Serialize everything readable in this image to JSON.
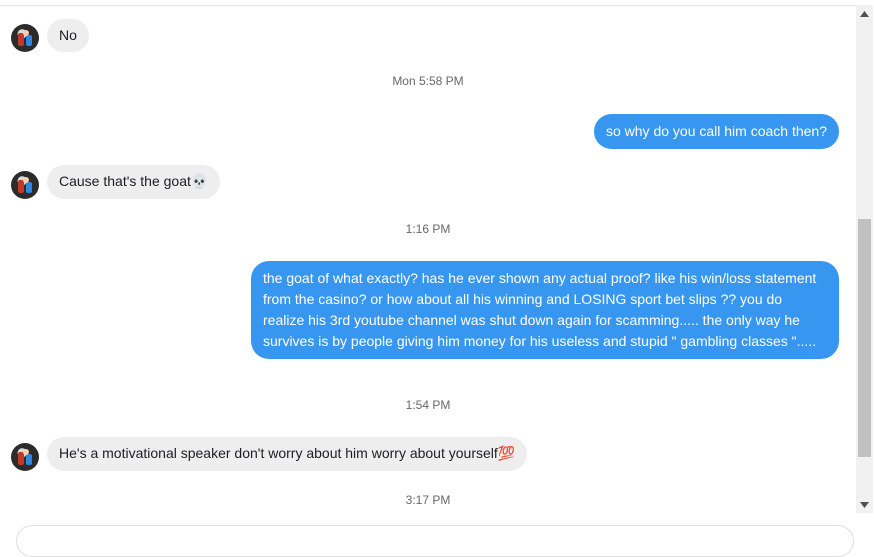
{
  "messages": [
    {
      "from": "them",
      "text": "No"
    },
    {
      "from": "me",
      "text": "so why do you call him coach then?"
    },
    {
      "from": "them",
      "text": "Cause that's the goat",
      "emoji": "💀"
    },
    {
      "from": "me",
      "text": "the goat of what exactly? has he ever shown any actual proof? like his win/loss statement from the casino? or how about all his winning and LOSING sport bet slips ?? you do realize his 3rd youtube channel was shut down again for scamming..... the only way he survives is by people giving him money for his useless and stupid  \" gambling classes \"....."
    },
    {
      "from": "them",
      "text": "He's a motivational speaker don't worry about him worry about yourself",
      "emoji": "💯"
    }
  ],
  "timestamps": [
    "Mon 5:58 PM",
    "1:16 PM",
    "1:54 PM",
    "3:17 PM"
  ],
  "icons": {
    "contact_avatar": "avatar",
    "scroll_up": "triangle-up-icon",
    "scroll_down": "triangle-down-icon"
  },
  "colors": {
    "outgoing_bubble": "#3797f0",
    "incoming_bubble": "#eeeeee",
    "timestamp": "#65676b"
  }
}
